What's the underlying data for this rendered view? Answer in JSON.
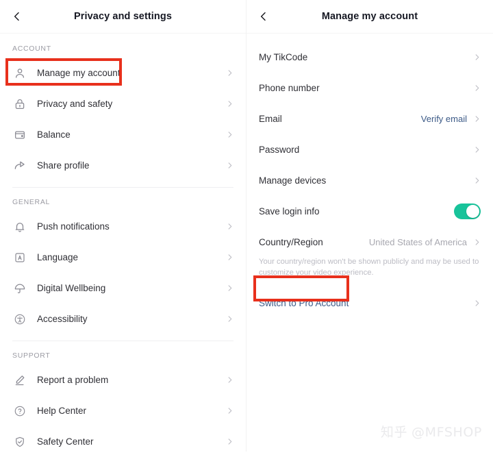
{
  "colors": {
    "annotation_box": "#e8301c",
    "toggle_on": "#18c39a",
    "link_blue": "#3c5a87",
    "value_gray": "#a8a8b0",
    "title_dark": "#161823"
  },
  "left_screen": {
    "nav": {
      "back_icon": "chevron-left-icon",
      "title": "Privacy and settings"
    },
    "sections": [
      {
        "label": "ACCOUNT",
        "items": [
          {
            "icon": "person-icon",
            "label": "Manage my account",
            "highlighted": true
          },
          {
            "icon": "lock-icon",
            "label": "Privacy and safety",
            "highlighted": false
          },
          {
            "icon": "wallet-icon",
            "label": "Balance",
            "highlighted": false
          },
          {
            "icon": "share-arrow-icon",
            "label": "Share profile",
            "highlighted": false
          }
        ]
      },
      {
        "label": "GENERAL",
        "items": [
          {
            "icon": "bell-icon",
            "label": "Push notifications",
            "highlighted": false
          },
          {
            "icon": "language-a-icon",
            "label": "Language",
            "highlighted": false
          },
          {
            "icon": "umbrella-icon",
            "label": "Digital Wellbeing",
            "highlighted": false
          },
          {
            "icon": "accessibility-icon",
            "label": "Accessibility",
            "highlighted": false
          }
        ]
      },
      {
        "label": "SUPPORT",
        "items": [
          {
            "icon": "pencil-icon",
            "label": "Report a problem",
            "highlighted": false
          },
          {
            "icon": "question-circle-icon",
            "label": "Help Center",
            "highlighted": false
          },
          {
            "icon": "shield-check-icon",
            "label": "Safety Center",
            "highlighted": false
          }
        ]
      }
    ]
  },
  "right_screen": {
    "nav": {
      "back_icon": "chevron-left-icon",
      "title": "Manage my account"
    },
    "items": [
      {
        "label": "My TikCode",
        "value": "",
        "type": "chevron"
      },
      {
        "label": "Phone number",
        "value": "",
        "type": "chevron"
      },
      {
        "label": "Email",
        "value": "Verify email",
        "value_style": "link",
        "type": "chevron"
      },
      {
        "label": "Password",
        "value": "",
        "type": "chevron"
      },
      {
        "label": "Manage devices",
        "value": "",
        "type": "chevron"
      },
      {
        "label": "Save login info",
        "value": "",
        "type": "toggle",
        "toggle_on": true
      },
      {
        "label": "Country/Region",
        "value": "United States of America",
        "type": "chevron"
      }
    ],
    "help_text": "Your country/region won't be shown publicly and may be used to customize your video experience.",
    "pro_account": {
      "label": "Switch to Pro Account",
      "label_style": "link",
      "highlighted": true
    }
  },
  "watermark": {
    "mark": "知乎",
    "handle": "@MFSHOP"
  }
}
